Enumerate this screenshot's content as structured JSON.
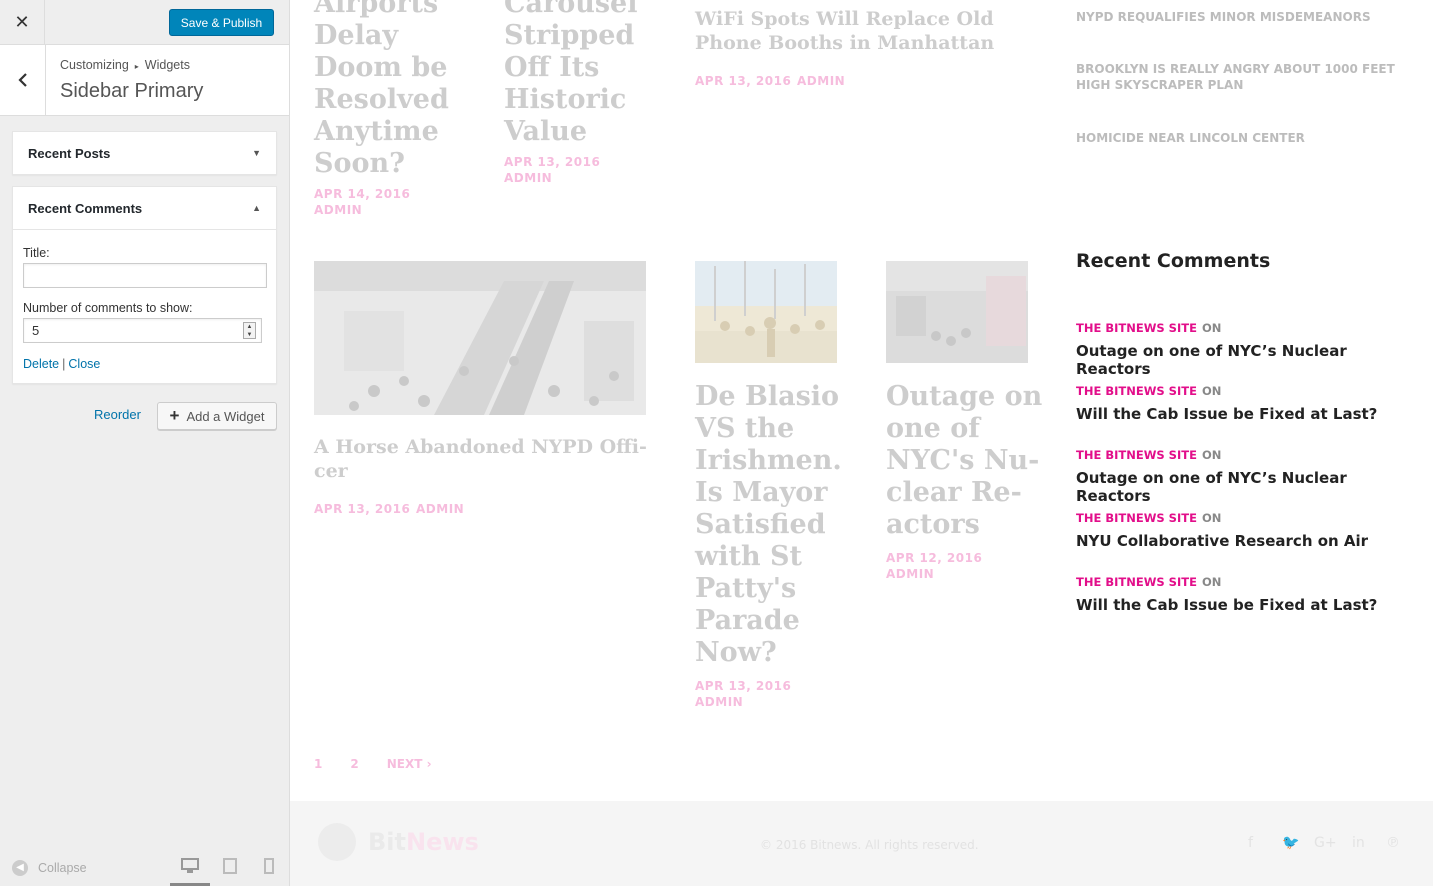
{
  "customizer": {
    "close_icon": "✕",
    "save_label": "Save & Publish",
    "breadcrumb": [
      "Customizing",
      "Widgets"
    ],
    "section_title": "Sidebar Primary",
    "widgets": [
      {
        "title": "Recent Posts",
        "expanded": false
      },
      {
        "title": "Recent Comments",
        "expanded": true
      }
    ],
    "form": {
      "title_label": "Title:",
      "title_value": "",
      "count_label": "Number of comments to show:",
      "count_value": "5",
      "delete_label": "Delete",
      "close_label": "Close"
    },
    "reorder_label": "Reorder",
    "add_widget_label": "Add a Widget",
    "collapse_label": "Collapse"
  },
  "preview": {
    "posts": [
      {
        "title_lines": [
          "Airports",
          "Delay",
          "Doom be",
          "Resolved",
          "Anytime",
          "Soon?"
        ],
        "date": "APR 14, 2016",
        "author": "ADMIN"
      },
      {
        "title_lines": [
          "Carousel",
          "Stripped",
          "Off Its",
          "Historic",
          "Value"
        ],
        "date": "APR 13, 2016",
        "author": "ADMIN"
      },
      {
        "title_lines": [
          "WiFi Spots Will Replace Old",
          "Phone Booths in Manhattan"
        ],
        "date": "APR 13, 2016",
        "author": "ADMIN"
      },
      {
        "title_lines": [
          "A Horse Abandoned NYPD Offi-",
          "cer"
        ],
        "date": "APR 13, 2016",
        "author": "ADMIN"
      },
      {
        "title_lines": [
          "De Blasio",
          "VS the",
          "Irishmen.",
          "Is Mayor",
          "Satisfied",
          "with St",
          "Patty's",
          "Parade",
          "Now?"
        ],
        "date": "APR 13, 2016",
        "author": "ADMIN"
      },
      {
        "title_lines": [
          "Outage on",
          "one of",
          "NYC's Nu-",
          "clear Re-",
          "actors"
        ],
        "date": "APR 12, 2016",
        "author": "ADMIN"
      }
    ],
    "sidebar_posts": [
      "NYPD REQUALIFIES MINOR MISDEMEANORS",
      "BROOKLYN IS REALLY ANGRY ABOUT 1000 FEET HIGH SKYSCRAPER PLAN",
      "HOMICIDE NEAR LINCOLN CENTER"
    ],
    "recent_comments_heading": "Recent Comments",
    "recent_comments": [
      {
        "author": "THE BITNEWS SITE",
        "on": "ON",
        "post": "Outage on one of NYC’s Nuclear Reactors"
      },
      {
        "author": "THE BITNEWS SITE",
        "on": "ON",
        "post": "Will the Cab Issue be Fixed at Last?"
      },
      {
        "author": "THE BITNEWS SITE",
        "on": "ON",
        "post": "Outage on one of NYC’s Nuclear Reactors"
      },
      {
        "author": "THE BITNEWS SITE",
        "on": "ON",
        "post": "NYU Collaborative Research on Air"
      },
      {
        "author": "THE BITNEWS SITE",
        "on": "ON",
        "post": "Will the Cab Issue be Fixed at Last?"
      }
    ],
    "pagination": [
      "1",
      "2",
      "NEXT ›"
    ],
    "footer": {
      "logo_a": "Bit",
      "logo_b": "News",
      "copyright": "© 2016 Bitnews. All rights reserved."
    }
  }
}
